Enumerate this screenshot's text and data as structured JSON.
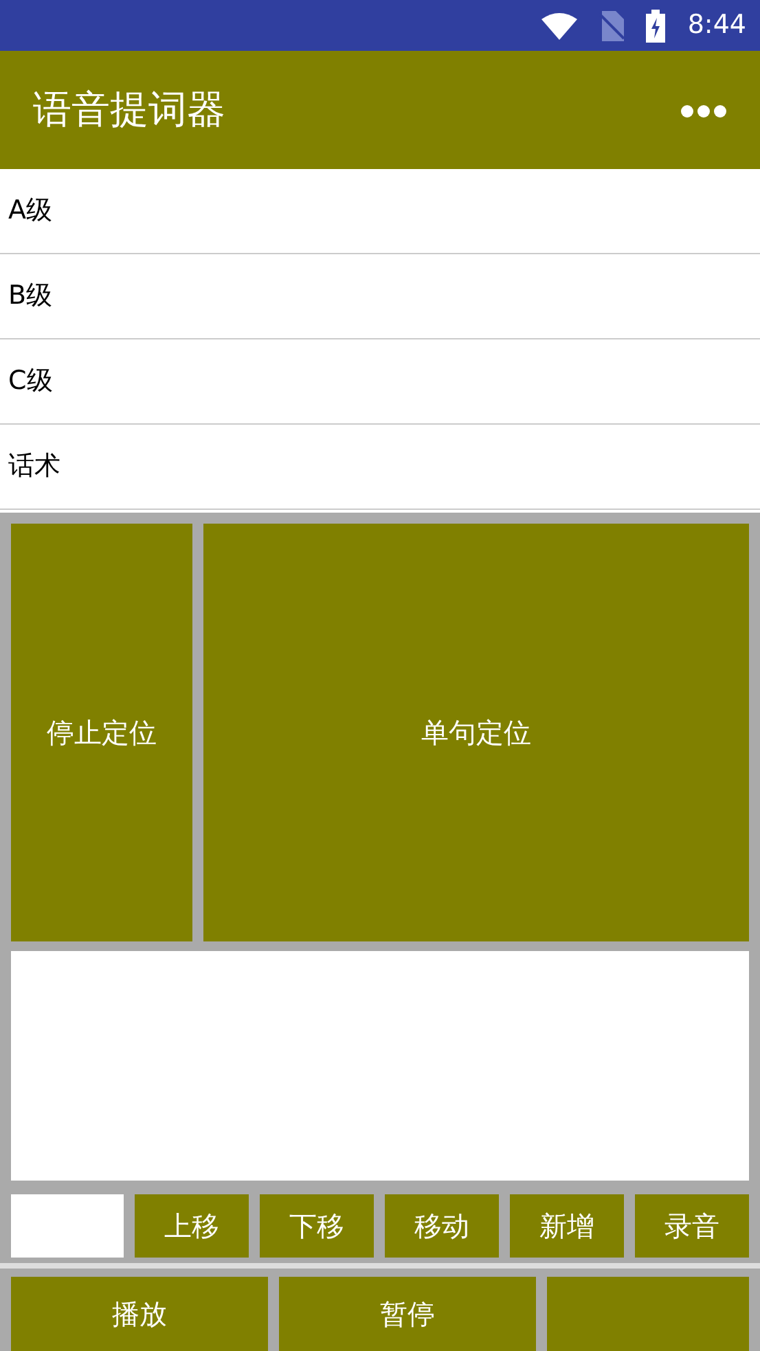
{
  "status_bar": {
    "time": "8:44"
  },
  "app_bar": {
    "title": "语音提词器"
  },
  "list_items": [
    {
      "label": "A级"
    },
    {
      "label": "B级"
    },
    {
      "label": "C级"
    },
    {
      "label": "话术"
    }
  ],
  "locate_buttons": [
    {
      "label": "停止定位"
    },
    {
      "label": "单句定位"
    }
  ],
  "action_buttons": [
    {
      "label": "上移"
    },
    {
      "label": "下移"
    },
    {
      "label": "移动"
    },
    {
      "label": "新增"
    },
    {
      "label": "录音"
    }
  ],
  "play_buttons": [
    {
      "kind": "labeled",
      "label": "播放"
    },
    {
      "kind": "labeled",
      "label": "暂停"
    },
    {
      "kind": "blank"
    }
  ]
}
